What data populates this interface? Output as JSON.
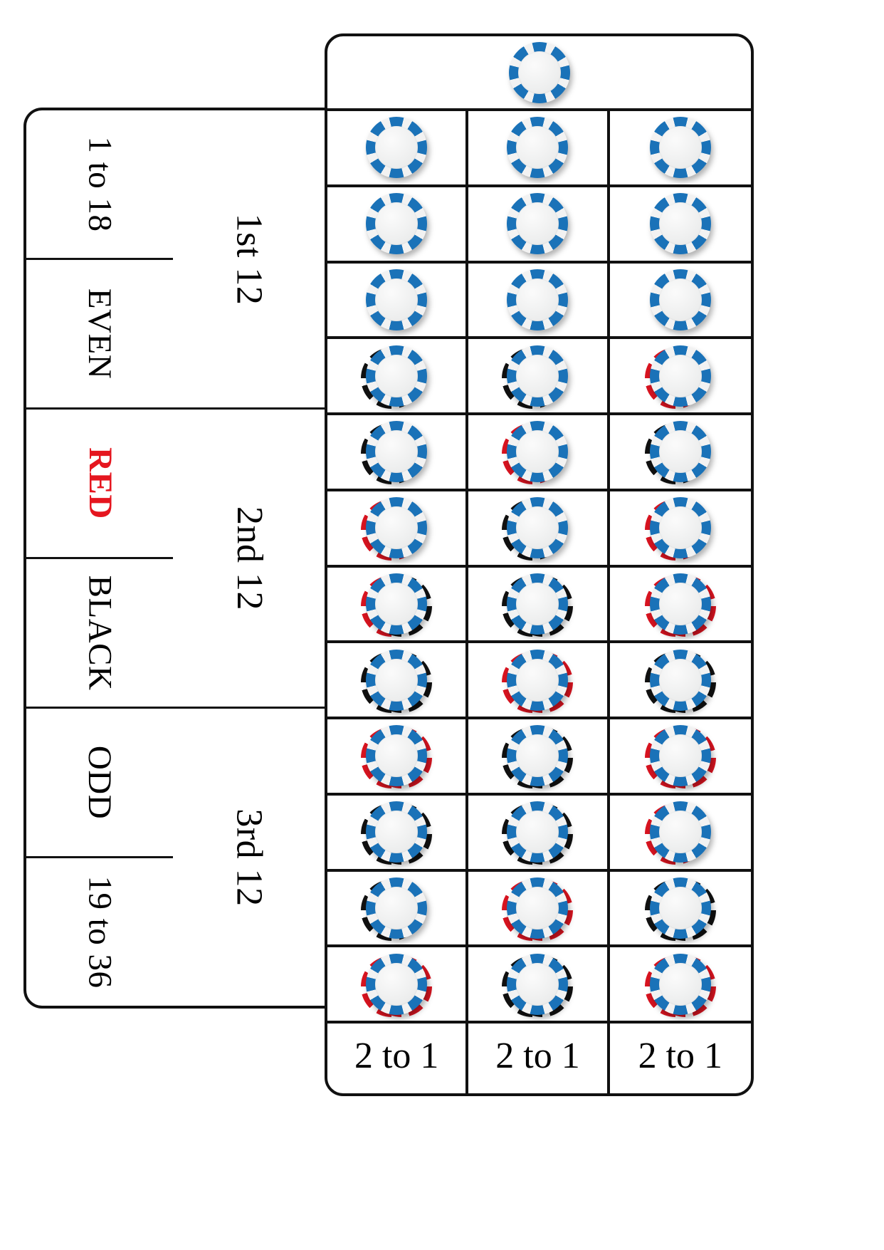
{
  "board": {
    "title": "Roulette betting layout with chip stacks",
    "colors": {
      "chip_blue": "#1a72b8",
      "chip_face": "#eceded",
      "chip_red": "#d81420",
      "chip_black": "#111111",
      "red_text": "#e5161f",
      "line": "#111111",
      "background": "#ffffff"
    }
  },
  "outside_bets": {
    "halves_column": [
      {
        "label": "1 to 18",
        "color": "black"
      },
      {
        "label": "EVEN",
        "color": "black"
      },
      {
        "label": "RED",
        "color": "red"
      },
      {
        "label": "BLACK",
        "color": "black"
      },
      {
        "label": "ODD",
        "color": "black"
      },
      {
        "label": "19 to 36",
        "color": "black"
      }
    ],
    "dozens_column": [
      {
        "label": "1st 12"
      },
      {
        "label": "2nd 12"
      },
      {
        "label": "3rd 12"
      }
    ]
  },
  "column_bets": [
    {
      "label": "2 to 1"
    },
    {
      "label": "2 to 1"
    },
    {
      "label": "2 to 1"
    }
  ],
  "zero_cell": {
    "chip": {
      "top": "blue",
      "under": []
    }
  },
  "grid": {
    "rows": 12,
    "cols": 3,
    "cells": [
      {
        "row": 1,
        "col": 1,
        "chip": {
          "top": "blue",
          "under": []
        }
      },
      {
        "row": 1,
        "col": 2,
        "chip": {
          "top": "blue",
          "under": []
        }
      },
      {
        "row": 1,
        "col": 3,
        "chip": {
          "top": "blue",
          "under": []
        }
      },
      {
        "row": 2,
        "col": 1,
        "chip": {
          "top": "blue",
          "under": []
        }
      },
      {
        "row": 2,
        "col": 2,
        "chip": {
          "top": "blue",
          "under": []
        }
      },
      {
        "row": 2,
        "col": 3,
        "chip": {
          "top": "blue",
          "under": []
        }
      },
      {
        "row": 3,
        "col": 1,
        "chip": {
          "top": "blue",
          "under": []
        }
      },
      {
        "row": 3,
        "col": 2,
        "chip": {
          "top": "blue",
          "under": []
        }
      },
      {
        "row": 3,
        "col": 3,
        "chip": {
          "top": "blue",
          "under": []
        }
      },
      {
        "row": 4,
        "col": 1,
        "chip": {
          "top": "blue",
          "under": [
            "black"
          ]
        }
      },
      {
        "row": 4,
        "col": 2,
        "chip": {
          "top": "blue",
          "under": [
            "black"
          ]
        }
      },
      {
        "row": 4,
        "col": 3,
        "chip": {
          "top": "blue",
          "under": [
            "red"
          ]
        }
      },
      {
        "row": 5,
        "col": 1,
        "chip": {
          "top": "blue",
          "under": [
            "black"
          ]
        }
      },
      {
        "row": 5,
        "col": 2,
        "chip": {
          "top": "blue",
          "under": [
            "red"
          ]
        }
      },
      {
        "row": 5,
        "col": 3,
        "chip": {
          "top": "blue",
          "under": [
            "black"
          ]
        }
      },
      {
        "row": 6,
        "col": 1,
        "chip": {
          "top": "blue",
          "under": [
            "red"
          ]
        }
      },
      {
        "row": 6,
        "col": 2,
        "chip": {
          "top": "blue",
          "under": [
            "black"
          ]
        }
      },
      {
        "row": 6,
        "col": 3,
        "chip": {
          "top": "blue",
          "under": [
            "red"
          ]
        }
      },
      {
        "row": 7,
        "col": 1,
        "chip": {
          "top": "blue",
          "under": [
            "red",
            "black"
          ]
        }
      },
      {
        "row": 7,
        "col": 2,
        "chip": {
          "top": "blue",
          "under": [
            "black",
            "black"
          ]
        }
      },
      {
        "row": 7,
        "col": 3,
        "chip": {
          "top": "blue",
          "under": [
            "red",
            "red"
          ]
        }
      },
      {
        "row": 8,
        "col": 1,
        "chip": {
          "top": "blue",
          "under": [
            "black",
            "black"
          ]
        }
      },
      {
        "row": 8,
        "col": 2,
        "chip": {
          "top": "blue",
          "under": [
            "red",
            "red"
          ]
        }
      },
      {
        "row": 8,
        "col": 3,
        "chip": {
          "top": "blue",
          "under": [
            "black",
            "black"
          ]
        }
      },
      {
        "row": 9,
        "col": 1,
        "chip": {
          "top": "blue",
          "under": [
            "red",
            "red"
          ]
        }
      },
      {
        "row": 9,
        "col": 2,
        "chip": {
          "top": "blue",
          "under": [
            "black",
            "black"
          ]
        }
      },
      {
        "row": 9,
        "col": 3,
        "chip": {
          "top": "blue",
          "under": [
            "red",
            "red"
          ]
        }
      },
      {
        "row": 10,
        "col": 1,
        "chip": {
          "top": "blue",
          "under": [
            "black",
            "black"
          ]
        }
      },
      {
        "row": 10,
        "col": 2,
        "chip": {
          "top": "blue",
          "under": [
            "black",
            "black"
          ]
        }
      },
      {
        "row": 10,
        "col": 3,
        "chip": {
          "top": "blue",
          "under": [
            "red"
          ]
        }
      },
      {
        "row": 11,
        "col": 1,
        "chip": {
          "top": "blue",
          "under": [
            "black"
          ]
        }
      },
      {
        "row": 11,
        "col": 2,
        "chip": {
          "top": "blue",
          "under": [
            "red",
            "red"
          ]
        }
      },
      {
        "row": 11,
        "col": 3,
        "chip": {
          "top": "blue",
          "under": [
            "black",
            "black"
          ]
        }
      },
      {
        "row": 12,
        "col": 1,
        "chip": {
          "top": "blue",
          "under": [
            "red",
            "red"
          ]
        }
      },
      {
        "row": 12,
        "col": 2,
        "chip": {
          "top": "blue",
          "under": [
            "black",
            "black"
          ]
        }
      },
      {
        "row": 12,
        "col": 3,
        "chip": {
          "top": "blue",
          "under": [
            "red",
            "red"
          ]
        }
      }
    ]
  }
}
